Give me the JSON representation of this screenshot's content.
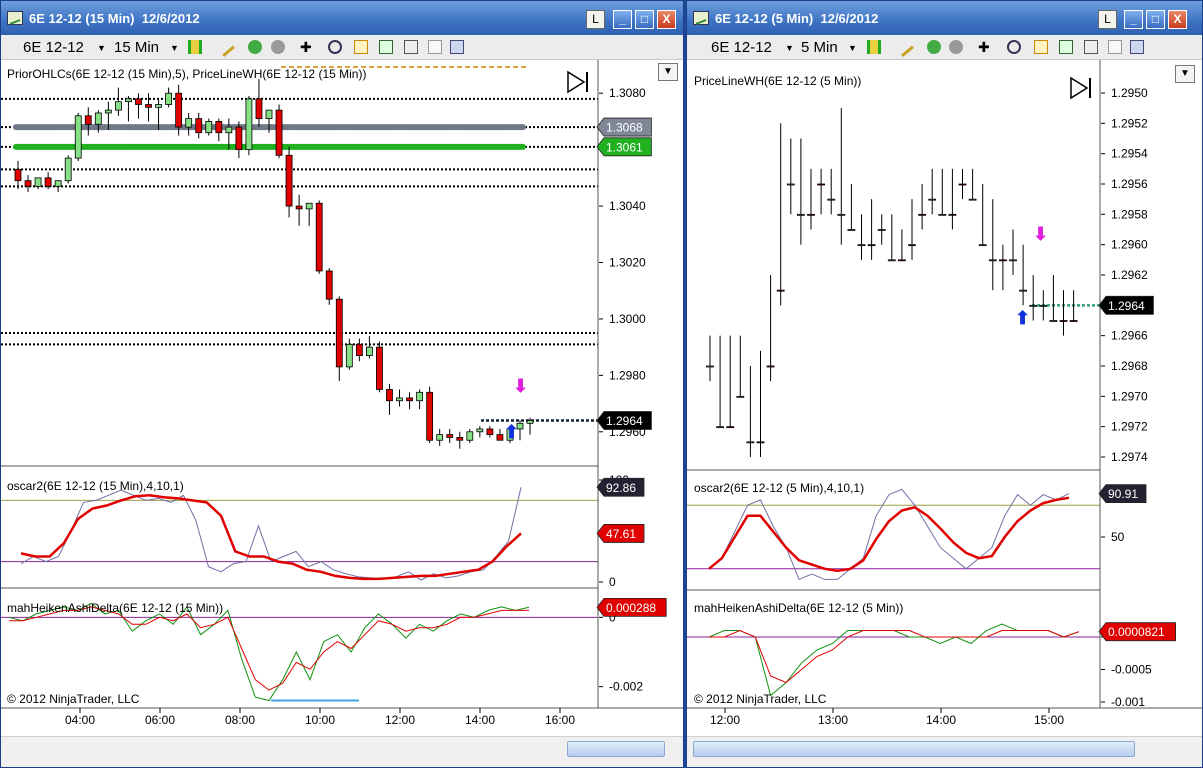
{
  "colors": {
    "bull": "#86e086",
    "bear": "#e00000",
    "priorGrey": "#707888",
    "priorGreen": "#20b020",
    "orange": "#e0a040",
    "oscFast": "#7070a8",
    "oscSlow": "#e00000",
    "hkRed": "#e00000",
    "hkGreen": "#109010",
    "purple": "#8a209a",
    "olive": "#a0a040",
    "blueLine": "#40a0e8"
  },
  "left": {
    "title": "6E 12-12 (15 Min)  12/6/2012",
    "toolbar": {
      "instrument": "6E 12-12",
      "interval": "15 Min"
    },
    "buttons": {
      "l": "L",
      "min": "_",
      "max": "□",
      "close": "X"
    },
    "price_panel": {
      "label": "PriorOHLCs(6E  12-12  (15 Min),5),  PriceLineWH(6E  12-12  (15 Min))",
      "ticks": [
        "1.3080",
        "1.3060",
        "1.3040",
        "1.3020",
        "1.3000",
        "1.2980",
        "1.2960"
      ],
      "price_labels": [
        "1.3068",
        "1.3061",
        "1.2964"
      ]
    },
    "osc_panel": {
      "label": "oscar2(6E  12-12  (15 Min),4,10,1)",
      "ticks": [
        "100",
        "0"
      ],
      "labels": [
        "92.86",
        "47.61"
      ]
    },
    "hk_panel": {
      "label": "mahHeikenAshiDelta(6E  12-12  (15 Min))",
      "ticks": [
        "0",
        "-0.002"
      ],
      "labels": [
        "0.000288"
      ]
    },
    "copyright": "© 2012 NinjaTrader, LLC",
    "time_ticks": [
      "04:00",
      "06:00",
      "08:00",
      "10:00",
      "12:00",
      "14:00",
      "16:00"
    ]
  },
  "right": {
    "title": "6E 12-12 (5 Min)  12/6/2012",
    "toolbar": {
      "instrument": "6E 12-12",
      "interval": "5 Min"
    },
    "buttons": {
      "l": "L",
      "min": "_",
      "max": "□",
      "close": "X"
    },
    "price_panel": {
      "label": "PriceLineWH(6E  12-12  (5 Min))",
      "ticks": [
        "1.2974",
        "1.2972",
        "1.2970",
        "1.2968",
        "1.2966",
        "1.2964",
        "1.2962",
        "1.2960",
        "1.2958",
        "1.2956",
        "1.2954",
        "1.2952",
        "1.2950"
      ],
      "price_labels": [
        "1.2964"
      ]
    },
    "osc_panel": {
      "label": "oscar2(6E  12-12  (5 Min),4,10,1)",
      "ticks": [
        "50"
      ],
      "labels": [
        "90.91"
      ]
    },
    "hk_panel": {
      "label": "mahHeikenAshiDelta(6E  12-12  (5 Min))",
      "ticks": [
        "0",
        "-0.0005",
        "-0.001"
      ],
      "labels": [
        "0.0000821"
      ]
    },
    "copyright": "© 2012 NinjaTrader, LLC",
    "time_ticks": [
      "12:00",
      "13:00",
      "14:00",
      "15:00"
    ]
  },
  "chart_data": [
    {
      "type": "candlestick",
      "name": "6E 12-12 (15 Min)",
      "ylim": [
        1.295,
        1.309
      ],
      "price_levels": [
        1.3078,
        1.3068,
        1.3061,
        1.3053,
        1.3047,
        1.2995,
        1.2991,
        1.2964
      ],
      "candles": [
        [
          1.3053,
          1.3056,
          1.3046,
          1.3049
        ],
        [
          1.3049,
          1.3051,
          1.3045,
          1.3047
        ],
        [
          1.3047,
          1.305,
          1.3046,
          1.305
        ],
        [
          1.305,
          1.3052,
          1.3046,
          1.3047
        ],
        [
          1.3047,
          1.3049,
          1.3045,
          1.3049
        ],
        [
          1.3049,
          1.3058,
          1.3048,
          1.3057
        ],
        [
          1.3057,
          1.3073,
          1.3056,
          1.3072
        ],
        [
          1.3072,
          1.3075,
          1.3065,
          1.3069
        ],
        [
          1.3069,
          1.3074,
          1.3066,
          1.3073
        ],
        [
          1.3073,
          1.3077,
          1.3067,
          1.3074
        ],
        [
          1.3074,
          1.3082,
          1.3072,
          1.3077
        ],
        [
          1.3077,
          1.3079,
          1.307,
          1.3078
        ],
        [
          1.3078,
          1.308,
          1.3071,
          1.3076
        ],
        [
          1.3076,
          1.308,
          1.307,
          1.3075
        ],
        [
          1.3075,
          1.3078,
          1.3067,
          1.3076
        ],
        [
          1.3076,
          1.3082,
          1.3075,
          1.308
        ],
        [
          1.308,
          1.3083,
          1.3065,
          1.3068
        ],
        [
          1.3068,
          1.3073,
          1.3065,
          1.3071
        ],
        [
          1.3071,
          1.3073,
          1.3064,
          1.3066
        ],
        [
          1.3066,
          1.3071,
          1.3065,
          1.307
        ],
        [
          1.307,
          1.3071,
          1.3063,
          1.3066
        ],
        [
          1.3066,
          1.3071,
          1.306,
          1.3068
        ],
        [
          1.3068,
          1.307,
          1.3057,
          1.306
        ],
        [
          1.306,
          1.3079,
          1.3058,
          1.3078
        ],
        [
          1.3078,
          1.3085,
          1.3068,
          1.3071
        ],
        [
          1.3071,
          1.3074,
          1.3066,
          1.3074
        ],
        [
          1.3074,
          1.3076,
          1.3057,
          1.3058
        ],
        [
          1.3058,
          1.3061,
          1.3036,
          1.304
        ],
        [
          1.304,
          1.3044,
          1.3033,
          1.3039
        ],
        [
          1.3039,
          1.3041,
          1.3033,
          1.3041
        ],
        [
          1.3041,
          1.3042,
          1.3016,
          1.3017
        ],
        [
          1.3017,
          1.3018,
          1.3005,
          1.3007
        ],
        [
          1.3007,
          1.3008,
          1.2978,
          1.2983
        ],
        [
          1.2983,
          1.2993,
          1.2982,
          1.2991
        ],
        [
          1.2991,
          1.2993,
          1.2985,
          1.2987
        ],
        [
          1.2987,
          1.2994,
          1.2986,
          1.299
        ],
        [
          1.299,
          1.2992,
          1.2974,
          1.2975
        ],
        [
          1.2975,
          1.2977,
          1.2966,
          1.2971
        ],
        [
          1.2971,
          1.2975,
          1.2969,
          1.2972
        ],
        [
          1.2972,
          1.2974,
          1.2968,
          1.2971
        ],
        [
          1.2971,
          1.2975,
          1.2968,
          1.2974
        ],
        [
          1.2974,
          1.2976,
          1.2956,
          1.2957
        ],
        [
          1.2957,
          1.2961,
          1.2955,
          1.2959
        ],
        [
          1.2959,
          1.2961,
          1.2956,
          1.2958
        ],
        [
          1.2958,
          1.296,
          1.2954,
          1.2957
        ],
        [
          1.2957,
          1.2961,
          1.2956,
          1.296
        ],
        [
          1.296,
          1.2962,
          1.2958,
          1.2961
        ],
        [
          1.2961,
          1.2962,
          1.2958,
          1.2959
        ],
        [
          1.2959,
          1.2961,
          1.2957,
          1.2957
        ],
        [
          1.2957,
          1.2962,
          1.2956,
          1.2961
        ],
        [
          1.2961,
          1.2964,
          1.2957,
          1.2963
        ],
        [
          1.2963,
          1.2965,
          1.2959,
          1.2964
        ]
      ]
    },
    {
      "type": "line",
      "name": "oscar2 (15 Min)",
      "ylim": [
        0,
        100
      ],
      "levels": [
        80,
        20
      ],
      "series": [
        {
          "name": "fast",
          "values": [
            18,
            25,
            20,
            25,
            50,
            78,
            80,
            85,
            90,
            85,
            80,
            82,
            78,
            85,
            60,
            15,
            10,
            18,
            20,
            55,
            20,
            25,
            30,
            15,
            20,
            12,
            8,
            5,
            4,
            3,
            5,
            10,
            2,
            8,
            4,
            6,
            10,
            12,
            25,
            40,
            92.86
          ]
        },
        {
          "name": "slow",
          "values": [
            28,
            25,
            25,
            38,
            62,
            72,
            75,
            80,
            84,
            85,
            83,
            82,
            80,
            78,
            65,
            30,
            25,
            25,
            20,
            18,
            12,
            10,
            6,
            4,
            3,
            3,
            4,
            5,
            6,
            6,
            8,
            10,
            12,
            20,
            35,
            47.61
          ]
        }
      ]
    },
    {
      "type": "line",
      "name": "mahHeikenAshiDelta (15 Min)",
      "ylim": [
        -0.0025,
        0.0005
      ],
      "series": [
        {
          "name": "green",
          "values": [
            0,
            -0.0001,
            0.0001,
            0.0002,
            0.0003,
            0.0002,
            0.0004,
            0.0001,
            0.0002,
            -0.0004,
            -0.0001,
            0.0001,
            -0.0002,
            0.0003,
            -0.0005,
            -0.0002,
            0.0002,
            -0.0012,
            -0.0023,
            -0.0024,
            -0.0018,
            -0.001,
            -0.0018,
            -0.0007,
            -0.0005,
            -0.001,
            -0.0003,
            0.0001,
            -0.0002,
            -0.0006,
            -0.0002,
            -0.0004,
            -0.0001,
            0.0001,
            0,
            0.0002,
            0.0003,
            0.0002,
            0.000288
          ]
        },
        {
          "name": "red",
          "values": [
            -0.0001,
            -0.0001,
            0,
            0.0001,
            0.0002,
            0.0002,
            0.0003,
            0.0002,
            0.0001,
            -0.0002,
            -0.0002,
            0,
            -0.0001,
            0.0001,
            -0.0003,
            -0.0002,
            0,
            -0.0009,
            -0.0018,
            -0.0021,
            -0.0019,
            -0.0013,
            -0.0015,
            -0.001,
            -0.0007,
            -0.0009,
            -0.0005,
            -0.0001,
            -0.0002,
            -0.0004,
            -0.0003,
            -0.0003,
            -0.0002,
            0,
            0,
            0.0001,
            0.0002,
            0.0002,
            0.0002
          ]
        }
      ]
    },
    {
      "type": "candlestick",
      "name": "6E 12-12 (5 Min)",
      "ylim": [
        1.2949,
        1.2976
      ],
      "price_levels": [
        1.2964
      ],
      "candles": [
        [
          1.2967,
          1.2969,
          1.2966,
          1.2968
        ],
        [
          1.2968,
          1.2972,
          1.2966,
          1.2972
        ],
        [
          1.2972,
          1.2972,
          1.2966,
          1.2967
        ],
        [
          1.2967,
          1.297,
          1.2966,
          1.297
        ],
        [
          1.297,
          1.2974,
          1.2968,
          1.2973
        ],
        [
          1.2973,
          1.2974,
          1.2967,
          1.2968
        ],
        [
          1.2968,
          1.2969,
          1.2962,
          1.2963
        ],
        [
          1.2963,
          1.2964,
          1.2952,
          1.2955
        ],
        [
          1.2955,
          1.2958,
          1.2953,
          1.2956
        ],
        [
          1.2956,
          1.296,
          1.2953,
          1.2958
        ],
        [
          1.2958,
          1.2959,
          1.2955,
          1.2956
        ],
        [
          1.2956,
          1.2958,
          1.2955,
          1.2955
        ],
        [
          1.2955,
          1.2958,
          1.2955,
          1.2957
        ],
        [
          1.2957,
          1.296,
          1.2951,
          1.2958
        ],
        [
          1.2958,
          1.2959,
          1.2956,
          1.2959
        ],
        [
          1.2959,
          1.2961,
          1.2958,
          1.296
        ],
        [
          1.296,
          1.2961,
          1.2957,
          1.2959
        ],
        [
          1.2959,
          1.296,
          1.2958,
          1.2959
        ],
        [
          1.2959,
          1.2961,
          1.2958,
          1.2961
        ],
        [
          1.2961,
          1.2961,
          1.2959,
          1.296
        ],
        [
          1.296,
          1.2961,
          1.2957,
          1.2958
        ],
        [
          1.2958,
          1.2959,
          1.2956,
          1.2956
        ],
        [
          1.2956,
          1.2958,
          1.2955,
          1.2957
        ],
        [
          1.2957,
          1.2958,
          1.2955,
          1.2958
        ],
        [
          1.2958,
          1.2959,
          1.2955,
          1.2956
        ],
        [
          1.2956,
          1.2957,
          1.2955,
          1.2955
        ],
        [
          1.2955,
          1.2957,
          1.2955,
          1.2957
        ],
        [
          1.2957,
          1.296,
          1.2956,
          1.296
        ],
        [
          1.296,
          1.2963,
          1.2957,
          1.2961
        ],
        [
          1.2961,
          1.2963,
          1.296,
          1.296
        ],
        [
          1.296,
          1.2962,
          1.2959,
          1.2961
        ],
        [
          1.2961,
          1.2964,
          1.296,
          1.2963
        ],
        [
          1.2963,
          1.2965,
          1.2962,
          1.2964
        ],
        [
          1.2964,
          1.2965,
          1.2963,
          1.2964
        ],
        [
          1.2964,
          1.2965,
          1.2962,
          1.2965
        ],
        [
          1.2965,
          1.2966,
          1.2963,
          1.2964
        ],
        [
          1.2965,
          1.2965,
          1.2963,
          1.2964
        ]
      ]
    },
    {
      "type": "line",
      "name": "oscar2 (5 Min)",
      "ylim": [
        0,
        100
      ],
      "levels": [
        80,
        20
      ],
      "series": [
        {
          "name": "fast",
          "values": [
            20,
            30,
            55,
            80,
            85,
            60,
            40,
            10,
            15,
            10,
            10,
            20,
            30,
            70,
            90,
            95,
            80,
            60,
            40,
            30,
            20,
            30,
            40,
            70,
            90,
            80,
            90,
            85,
            90.91
          ]
        },
        {
          "name": "slow",
          "values": [
            20,
            30,
            50,
            70,
            70,
            55,
            40,
            28,
            24,
            20,
            18,
            20,
            28,
            48,
            65,
            75,
            78,
            70,
            58,
            45,
            35,
            30,
            32,
            50,
            65,
            75,
            82,
            85,
            87
          ]
        }
      ]
    },
    {
      "type": "line",
      "name": "mahHeikenAshiDelta (5 Min)",
      "ylim": [
        -0.001,
        0.0002
      ],
      "series": [
        {
          "name": "green",
          "values": [
            0,
            0.0001,
            0.0001,
            0,
            -0.0009,
            -0.0007,
            -0.0004,
            -0.0002,
            -0.0001,
            0.0001,
            0.0001,
            0.0001,
            0.0001,
            0,
            0,
            -0.0001,
            0,
            -0.0001,
            0.0001,
            0.0002,
            0.0001,
            0.0001,
            0.0001,
            0,
            8.21e-05
          ]
        },
        {
          "name": "red",
          "values": [
            0,
            0,
            0.0001,
            0,
            -0.0006,
            -0.0007,
            -0.0005,
            -0.0003,
            -0.0002,
            0,
            0.0001,
            0.0001,
            0.0001,
            0.0001,
            0,
            0,
            0,
            0,
            0,
            0.0001,
            0.0001,
            0.0001,
            0.0001,
            0,
            8.21e-05
          ]
        }
      ]
    }
  ]
}
